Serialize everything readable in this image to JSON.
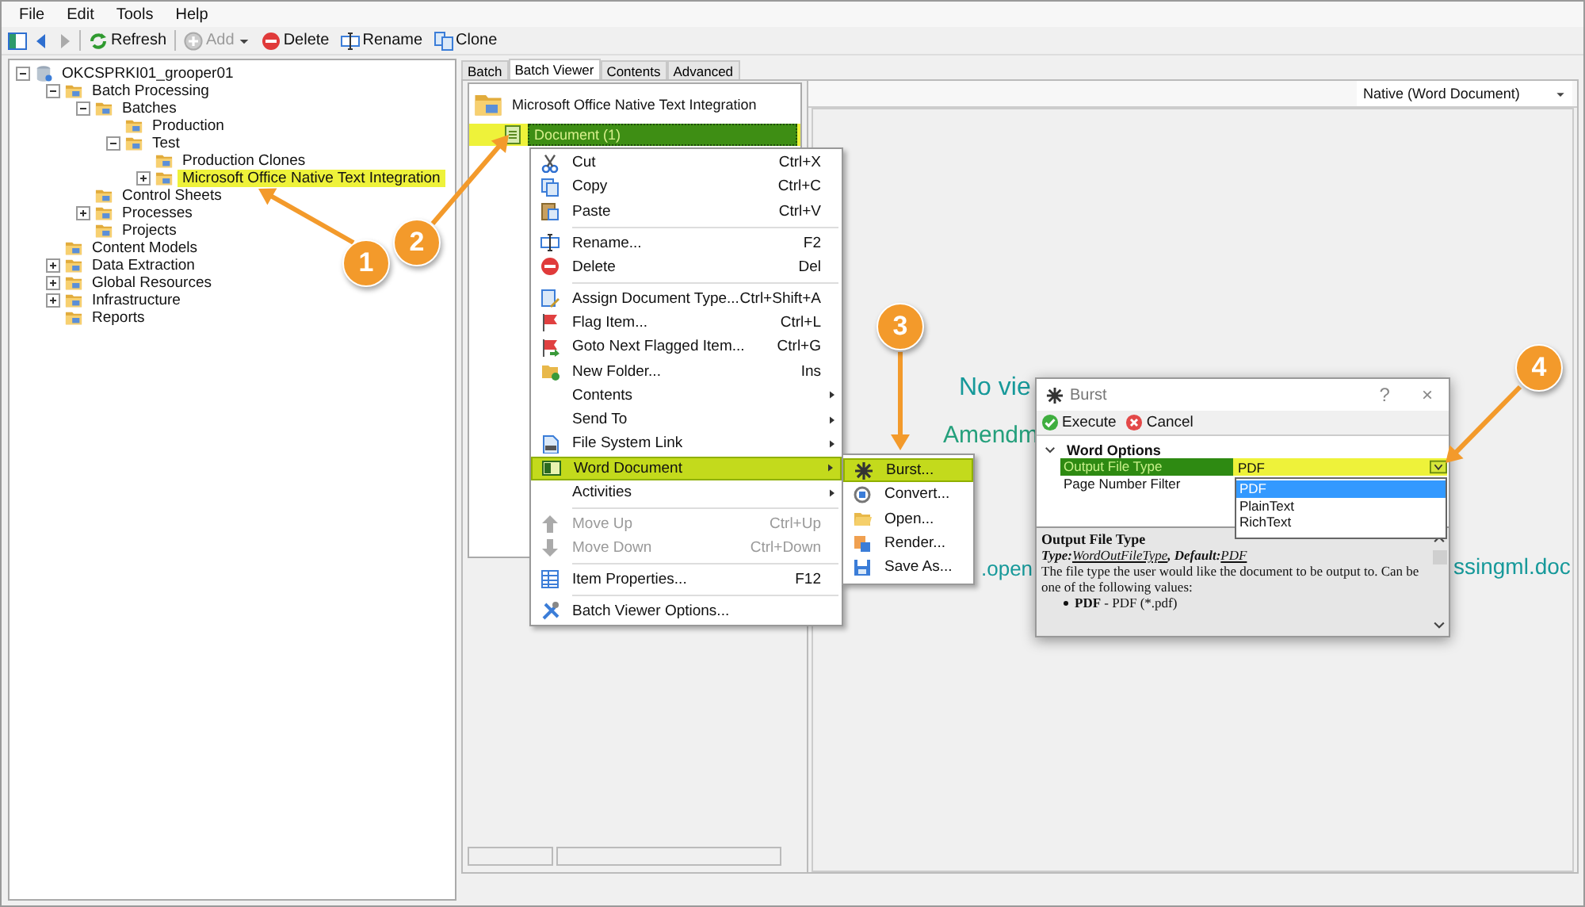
{
  "menu_bar": [
    "File",
    "Edit",
    "Tools",
    "Help"
  ],
  "toolbar": [
    {
      "label": "Refresh",
      "disabled": false,
      "dropdown": false
    },
    {
      "label": "Add",
      "disabled": true,
      "dropdown": true
    },
    {
      "label": "Delete",
      "disabled": false,
      "dropdown": false
    },
    {
      "label": "Rename",
      "disabled": false,
      "dropdown": false
    },
    {
      "label": "Clone",
      "disabled": false,
      "dropdown": false
    }
  ],
  "node_tree": {
    "label": "OKCSPRKI01_grooper01",
    "expanded": true,
    "selected": false,
    "children": [
      {
        "label": "Batch Processing",
        "expanded": true,
        "selected": false,
        "children": [
          {
            "label": "Batches",
            "expanded": true,
            "selected": false,
            "children": [
              {
                "label": "Production",
                "selected": false
              },
              {
                "label": "Test",
                "expanded": true,
                "selected": false,
                "children": [
                  {
                    "label": "Production Clones",
                    "selected": false
                  },
                  {
                    "label": "Microsoft Office Native Text Integration",
                    "expanded": false,
                    "selected": true
                  }
                ]
              }
            ]
          },
          {
            "label": "Control Sheets",
            "selected": false
          },
          {
            "label": "Processes",
            "expanded": false,
            "selected": false
          },
          {
            "label": "Projects",
            "selected": false
          }
        ]
      },
      {
        "label": "Content Models",
        "selected": false
      },
      {
        "label": "Data Extraction",
        "expanded": false,
        "selected": false
      },
      {
        "label": "Global Resources",
        "expanded": false,
        "selected": false
      },
      {
        "label": "Infrastructure",
        "expanded": false,
        "selected": false
      },
      {
        "label": "Reports",
        "selected": false
      }
    ]
  },
  "tabs": [
    {
      "label": "Batch",
      "selected": false
    },
    {
      "label": "Batch Viewer",
      "selected": true
    },
    {
      "label": "Contents",
      "selected": false
    },
    {
      "label": "Advanced",
      "selected": false
    }
  ],
  "batch_tree": {
    "label": "Microsoft Office Native Text Integration",
    "selected": false,
    "children": [
      {
        "label": "Document (1)",
        "selected": true
      }
    ]
  },
  "view_mode": {
    "value": "Native (Word Document)"
  },
  "document_text": [
    "No vie",
    "Amendm",
    ".open",
    "ssingml.doc"
  ],
  "context_menu": {
    "items": [
      {
        "kind": "item",
        "label": "Cut",
        "shortcut": "Ctrl+X",
        "submenu": false,
        "disabled": false,
        "selected": false
      },
      {
        "kind": "item",
        "label": "Copy",
        "shortcut": "Ctrl+C",
        "submenu": false,
        "disabled": false,
        "selected": false
      },
      {
        "kind": "item",
        "label": "Paste",
        "shortcut": "Ctrl+V",
        "submenu": false,
        "disabled": false,
        "selected": false
      },
      {
        "kind": "separator"
      },
      {
        "kind": "item",
        "label": "Rename...",
        "shortcut": "F2",
        "submenu": false,
        "disabled": false,
        "selected": false
      },
      {
        "kind": "item",
        "label": "Delete",
        "shortcut": "Del",
        "submenu": false,
        "disabled": false,
        "selected": false
      },
      {
        "kind": "separator"
      },
      {
        "kind": "item",
        "label": "Assign Document Type...",
        "shortcut": "Ctrl+Shift+A",
        "submenu": false,
        "disabled": false,
        "selected": false
      },
      {
        "kind": "item",
        "label": "Flag Item...",
        "shortcut": "Ctrl+L",
        "submenu": false,
        "disabled": false,
        "selected": false
      },
      {
        "kind": "item",
        "label": "Goto Next Flagged Item...",
        "shortcut": "Ctrl+G",
        "submenu": false,
        "disabled": false,
        "selected": false
      },
      {
        "kind": "item",
        "label": "New Folder...",
        "shortcut": "Ins",
        "submenu": false,
        "disabled": false,
        "selected": false
      },
      {
        "kind": "item",
        "label": "Contents",
        "submenu": true,
        "disabled": false,
        "selected": false
      },
      {
        "kind": "item",
        "label": "Send To",
        "submenu": true,
        "disabled": false,
        "selected": false
      },
      {
        "kind": "item",
        "label": "File System Link",
        "submenu": true,
        "disabled": false,
        "selected": false
      },
      {
        "kind": "item",
        "label": "Word Document",
        "submenu": true,
        "disabled": false,
        "selected": true
      },
      {
        "kind": "item",
        "label": "Activities",
        "submenu": true,
        "disabled": false,
        "selected": false
      },
      {
        "kind": "separator"
      },
      {
        "kind": "item",
        "label": "Move Up",
        "shortcut": "Ctrl+Up",
        "submenu": false,
        "disabled": true,
        "selected": false
      },
      {
        "kind": "item",
        "label": "Move Down",
        "shortcut": "Ctrl+Down",
        "submenu": false,
        "disabled": true,
        "selected": false
      },
      {
        "kind": "separator"
      },
      {
        "kind": "item",
        "label": "Item Properties...",
        "shortcut": "F12",
        "submenu": false,
        "disabled": false,
        "selected": false
      },
      {
        "kind": "separator"
      },
      {
        "kind": "item",
        "label": "Batch Viewer Options...",
        "submenu": false,
        "disabled": false,
        "selected": false
      }
    ]
  },
  "submenu": {
    "items": [
      {
        "label": "Burst...",
        "selected": true
      },
      {
        "label": "Convert...",
        "selected": false
      },
      {
        "label": "Open...",
        "selected": false
      },
      {
        "label": "Render...",
        "selected": false
      },
      {
        "label": "Save As...",
        "selected": false
      }
    ]
  },
  "dialog": {
    "title": "Burst",
    "help_button": "?",
    "close_button": "×",
    "actions": [
      "Execute",
      "Cancel"
    ],
    "category": {
      "label": "Word Options",
      "expanded": true
    },
    "properties": [
      {
        "name": "Output File Type",
        "value": "PDF",
        "selected": true
      },
      {
        "name": "Page Number Filter",
        "selected": false
      }
    ],
    "options": [
      {
        "label": "PDF",
        "selected": true
      },
      {
        "label": "PlainText",
        "selected": false
      },
      {
        "label": "RichText",
        "selected": false
      }
    ],
    "help": {
      "title": "Output File Type",
      "type_label": "Type:",
      "type_link": "WordOutFileType",
      "default_label": ", Default:",
      "default_link": "PDF",
      "description": "The file type the user would like the document to be output to. Can be one of the following values:",
      "bullets": [
        {
          "term": "PDF",
          "text": " - PDF (*.pdf)"
        }
      ]
    }
  },
  "callouts": [
    "1",
    "2",
    "3",
    "4"
  ]
}
